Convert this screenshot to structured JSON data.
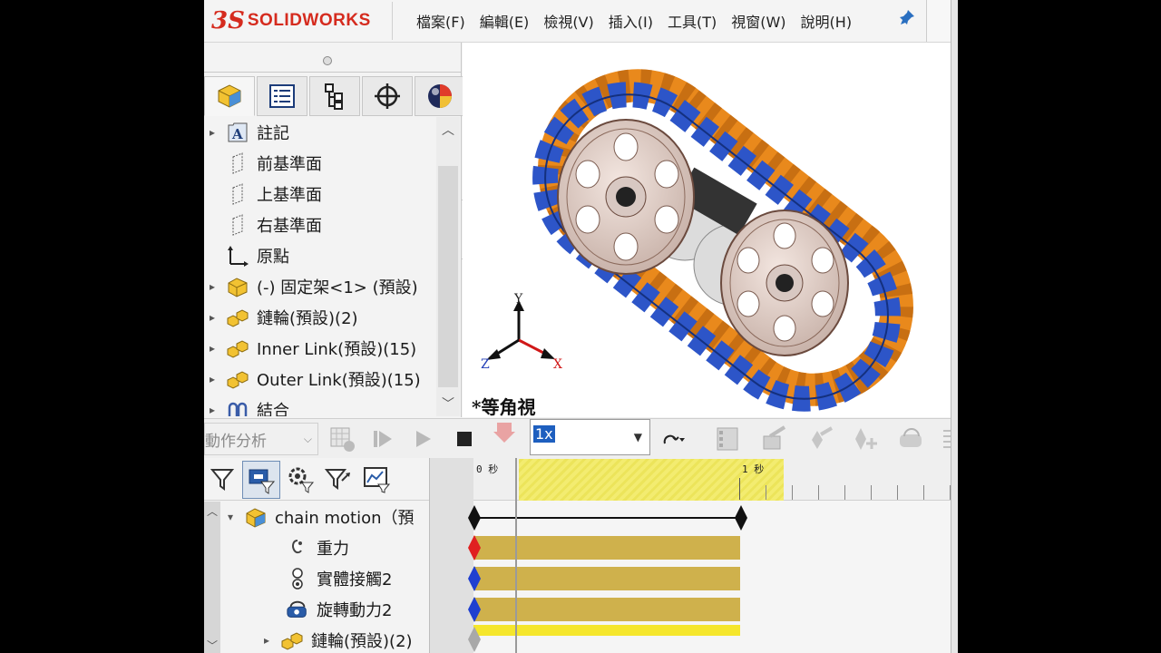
{
  "app": {
    "logo_ds": "3S",
    "logo_text": "SOLIDWORKS",
    "menu": [
      "檔案(F)",
      "編輯(E)",
      "檢視(V)",
      "插入(I)",
      "工具(T)",
      "視窗(W)",
      "說明(H)"
    ]
  },
  "feature_tree": {
    "items": [
      {
        "label": "註記",
        "icon": "annotations-icon",
        "expandable": true
      },
      {
        "label": "前基準面",
        "icon": "plane-icon",
        "expandable": false
      },
      {
        "label": "上基準面",
        "icon": "plane-icon",
        "expandable": false
      },
      {
        "label": "右基準面",
        "icon": "plane-icon",
        "expandable": false
      },
      {
        "label": "原點",
        "icon": "origin-icon",
        "expandable": false
      },
      {
        "label": "(-) 固定架<1> (預設)",
        "icon": "part-icon",
        "expandable": true
      },
      {
        "label": "鏈輪(預設)(2)",
        "icon": "assembly-icon",
        "expandable": true
      },
      {
        "label": "Inner Link(預設)(15)",
        "icon": "assembly-icon",
        "expandable": true
      },
      {
        "label": "Outer Link(預設)(15)",
        "icon": "assembly-icon",
        "expandable": true
      },
      {
        "label": "結合",
        "icon": "mates-icon",
        "expandable": true
      }
    ]
  },
  "viewport": {
    "view_label": "*等角視",
    "triad": {
      "x": "X",
      "y": "Y",
      "z": "Z"
    }
  },
  "motion_toolbar": {
    "study_type": "動作分析",
    "playback_speed": "1x"
  },
  "motion_tree": {
    "items": [
      {
        "label": "chain motion（預",
        "icon": "assembly-icon"
      },
      {
        "label": "重力",
        "icon": "gravity-icon"
      },
      {
        "label": "實體接觸2",
        "icon": "contact-icon"
      },
      {
        "label": "旋轉動力2",
        "icon": "motor-icon"
      },
      {
        "label": "鏈輪(預設)(2)",
        "icon": "assembly-icon"
      }
    ]
  },
  "timeline": {
    "tick_0": "0 秒",
    "tick_1": "1 秒",
    "current_time_fraction": 0.15,
    "key_colors": {
      "root": "#000000",
      "gravity": "#e02020",
      "contact": "#1f3fd0",
      "motor": "#1f3fd0",
      "component": "#a8a8a8"
    },
    "bar_color": "#cfb14c"
  }
}
